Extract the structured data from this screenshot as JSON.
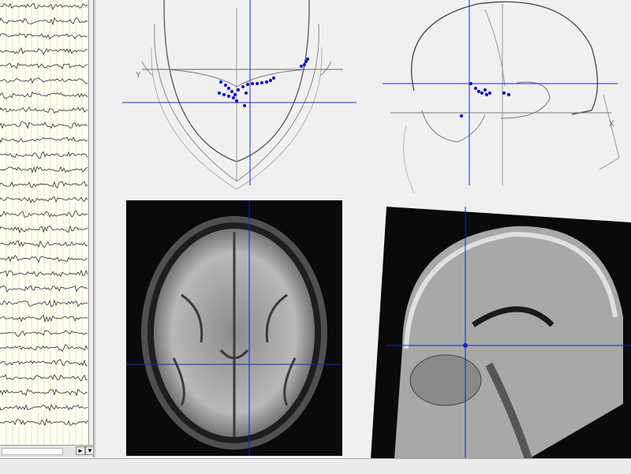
{
  "eeg_panel": {
    "channel_count": 19,
    "trace_color": "#2b2b2b",
    "grid_color": "#d6d6a8",
    "scroll_right_glyph": "►",
    "scroll_down_glyph": "▼"
  },
  "dipole_plots": {
    "top_view": {
      "axis_label_y": "Y",
      "dipole_color": "#1010c8"
    },
    "side_view": {
      "axis_label_x": "X",
      "dipole_color": "#1010c8"
    }
  },
  "mri_views": {
    "axial": {
      "name": "axial-slice"
    },
    "sagittal": {
      "name": "sagittal-slice"
    },
    "crosshair_color": "#2020c0"
  }
}
